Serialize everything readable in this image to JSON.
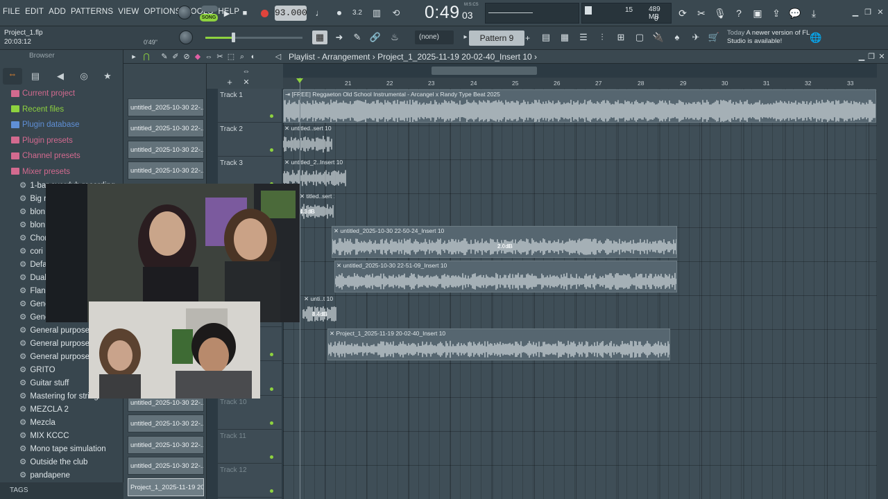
{
  "menu": [
    "FILE",
    "EDIT",
    "ADD",
    "PATTERNS",
    "VIEW",
    "OPTIONS",
    "TOOLS",
    "HELP"
  ],
  "transport": {
    "mode_label": "SONG",
    "tempo": "93.000",
    "time_main": "0:49",
    "time_sub": "03",
    "time_unit": "M:S:CS"
  },
  "system": {
    "cpu": "15",
    "memory": "489 MB",
    "polyphony": "0"
  },
  "project": {
    "file": "Project_1.flp",
    "time": "20:03:12",
    "length": "0'49\""
  },
  "toolbar": {
    "none_select": "(none)",
    "pattern": "Pattern 9",
    "pattern_add": "+"
  },
  "news": {
    "label": "Today",
    "text": "A newer version of FL Studio is available!"
  },
  "browser": {
    "title": "Browser",
    "top_items": [
      {
        "label": "Current project",
        "color": "#d36a8f"
      },
      {
        "label": "Recent files",
        "color": "#8ed23f"
      },
      {
        "label": "Plugin database",
        "color": "#5f8fd6"
      },
      {
        "label": "Plugin presets",
        "color": "#d36a8f"
      },
      {
        "label": "Channel presets",
        "color": "#d36a8f"
      },
      {
        "label": "Mixer presets",
        "color": "#d36a8f"
      }
    ],
    "sub_items": [
      "1-bar overdub recording",
      "Big r",
      "blon",
      "blon",
      "Chor",
      "cori",
      "Defa",
      "Dual",
      "Flan",
      "Gene",
      "Gene",
      "General purpose m",
      "General purpose m",
      "General purpose",
      "GRITO",
      "Guitar stuff",
      "Mastering for strings",
      "MEZCLA 2",
      "Mezcla",
      "MIX KCCC",
      "Mono tape simulation",
      "Outside the club",
      "pandapene"
    ],
    "tags_label": "TAGS"
  },
  "playlist": {
    "window_title": "Playlist - Arrangement",
    "project_name": "Project_1_2025-11-19 20-02-40_Insert 10",
    "ruler": [
      {
        "label": "21",
        "pos": 497
      },
      {
        "label": "22",
        "pos": 557
      },
      {
        "label": "23",
        "pos": 617
      },
      {
        "label": "24",
        "pos": 678
      },
      {
        "label": "25",
        "pos": 738
      },
      {
        "label": "26",
        "pos": 798
      },
      {
        "label": "27",
        "pos": 858
      },
      {
        "label": "28",
        "pos": 919
      },
      {
        "label": "29",
        "pos": 980
      },
      {
        "label": "30",
        "pos": 1040
      },
      {
        "label": "31",
        "pos": 1100
      },
      {
        "label": "32",
        "pos": 1160
      },
      {
        "label": "33",
        "pos": 1221
      }
    ],
    "picker": [
      "untitled_2025-10-30 22-...",
      "untitled_2025-10-30 22-...",
      "untitled_2025-10-30 22-...",
      "untitled_2025-10-30 22-...",
      "untitled_2025-10-30 22-...",
      "untitled_2025-10-30 22-...",
      "untitled_2025-10-30 22-...",
      "untitled_2025-10-30 22-...",
      "Project_1_2025-11-19 20..."
    ],
    "tracks": [
      "Track 1",
      "Track 2",
      "Track 3",
      "",
      "",
      "",
      "",
      "",
      "",
      "Track 10",
      "Track 11",
      "Track 12"
    ],
    "clips": [
      {
        "label": "[FREE] Reggaeton Old School Instrumental - Arcangel x Randy Type Beat 2025",
        "db": ""
      },
      {
        "label": "untitled..sert 10",
        "db": ""
      },
      {
        "label": "untitled_2..Insert 10",
        "db": ""
      },
      {
        "label": "titled..sert 10",
        "db": "4.3dB"
      },
      {
        "label": "untitled_2025-10-30 22-50-24_Insert 10",
        "db": "2.0dB"
      },
      {
        "label": "untitled_2025-10-30 22-51-09_Insert 10",
        "db": ""
      },
      {
        "label": "unti..t 10",
        "db": "8.4dB"
      },
      {
        "label": "Project_1_2025-11-19 20-02-40_Insert 10",
        "db": ""
      }
    ]
  },
  "colors": {
    "accent_green": "#8ed23f",
    "record_red": "#e0443c",
    "bg": "#3f4e57"
  }
}
